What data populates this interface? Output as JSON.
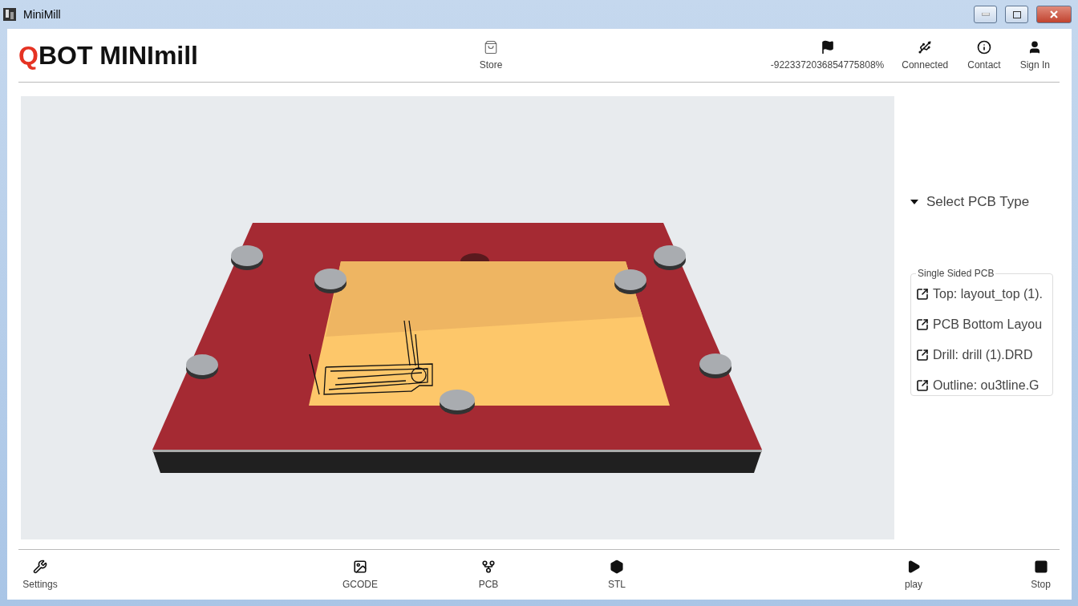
{
  "window": {
    "title": "MiniMill"
  },
  "header": {
    "logo_mark": "Q",
    "logo_text": "BOT MINImill",
    "center_items": [
      {
        "kind": "store",
        "label": "Store"
      }
    ],
    "right_items": [
      {
        "kind": "flag",
        "label": "-9223372036854775808%"
      },
      {
        "kind": "usb",
        "label": "Connected"
      },
      {
        "kind": "info",
        "label": "Contact"
      },
      {
        "kind": "user",
        "label": "Sign In"
      }
    ]
  },
  "side_panel": {
    "dropdown": {
      "label": "Select PCB Type",
      "expanded": false
    },
    "group": {
      "legend": "Single Sided PCB",
      "files": [
        "Top: layout_top (1).",
        "PCB Bottom Layou",
        "Drill: drill (1).DRD",
        "Outline: ou3tline.G"
      ]
    }
  },
  "footer": [
    {
      "kind": "settings",
      "label": "Settings"
    },
    {
      "kind": "spacer"
    },
    {
      "kind": "image",
      "label": "GCODE"
    },
    {
      "kind": "pcb",
      "label": "PCB"
    },
    {
      "kind": "stl",
      "label": "STL"
    },
    {
      "kind": "spacer"
    },
    {
      "kind": "play",
      "label": "play"
    },
    {
      "kind": "stop",
      "label": "Stop"
    }
  ]
}
